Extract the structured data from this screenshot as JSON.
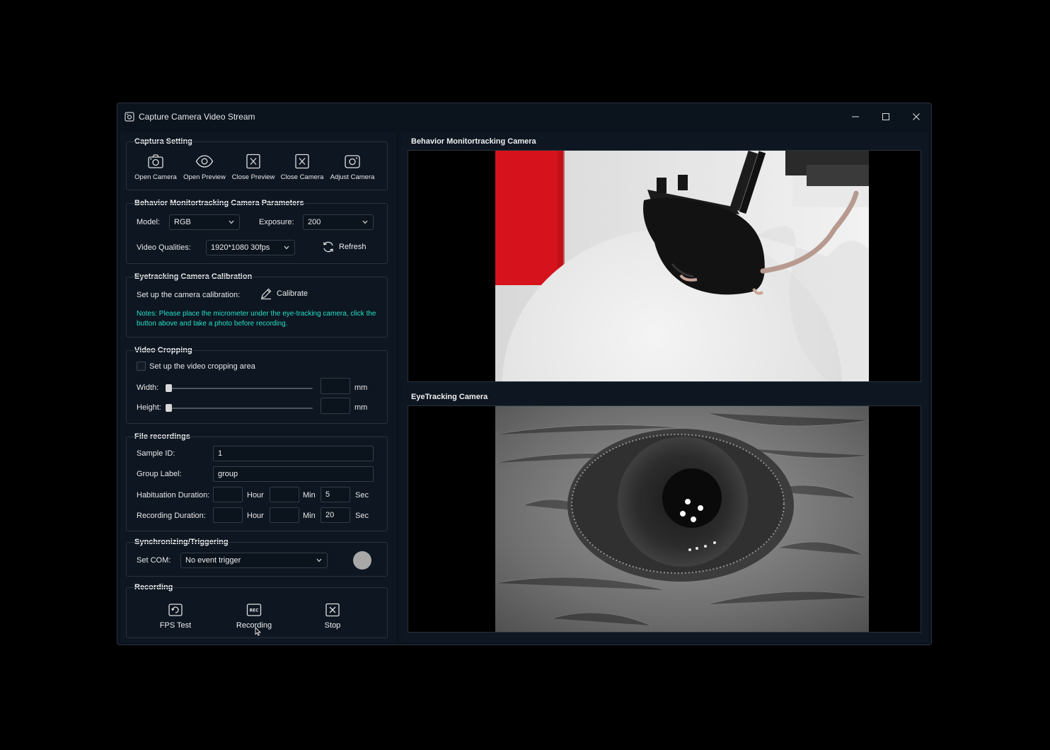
{
  "window": {
    "title": "Capture Camera Video Stream"
  },
  "capture_setting": {
    "title": "Captura Setting",
    "buttons": [
      {
        "label": "Open Camera",
        "icon": "camera-icon"
      },
      {
        "label": "Open Preview",
        "icon": "eye-icon"
      },
      {
        "label": "Close Preview",
        "icon": "close-box-icon"
      },
      {
        "label": "Close Camera",
        "icon": "close-box-icon"
      },
      {
        "label": "Adjust Camera",
        "icon": "camera-icon"
      }
    ]
  },
  "behavior_params": {
    "title": "Behavior Monitortracking Camera Parameters",
    "model_label": "Model:",
    "model_value": "RGB",
    "exposure_label": "Exposure:",
    "exposure_value": "200",
    "quality_label": "Video Qualities:",
    "quality_value": "1920*1080 30fps",
    "refresh_label": "Refresh"
  },
  "calibration": {
    "title": "Eyetracking Camera Calibration",
    "setup_label": "Set up the camera calibration:",
    "calibrate_label": "Calibrate",
    "note": "Notes: Please place the micrometer under the eye-tracking camera, click the button above and take a photo before recording."
  },
  "cropping": {
    "title": "Video Cropping",
    "checkbox_label": "Set up the video cropping area",
    "checked": false,
    "width_label": "Width:",
    "height_label": "Height:",
    "unit": "mm",
    "width_value": "",
    "height_value": ""
  },
  "file_recordings": {
    "title": "File recordings",
    "sample_id_label": "Sample ID:",
    "sample_id_value": "1",
    "group_label_label": "Group Label:",
    "group_label_value": "group",
    "habituation_label": "Habituation Duration:",
    "habituation": {
      "hour": "",
      "min": "",
      "sec": "5"
    },
    "recording_label": "Recording Duration:",
    "recording": {
      "hour": "",
      "min": "",
      "sec": "20"
    },
    "hour_unit": "Hour",
    "min_unit": "Min",
    "sec_unit": "Sec"
  },
  "sync": {
    "title": "Synchronizing/Triggering",
    "com_label": "Set COM:",
    "com_value": "No event trigger",
    "status_color": "#a8a8a8"
  },
  "recording": {
    "title": "Recording",
    "fps_label": "FPS Test",
    "record_label": "Recording",
    "rec_badge": "REC",
    "stop_label": "Stop"
  },
  "cameras": {
    "behavior_title": "Behavior Monitortracking Camera",
    "eye_title": "EyeTracking Camera"
  },
  "colors": {
    "accent_note": "#27e0c6",
    "window_bg": "#0b131d",
    "panel_bg": "#0d1621"
  }
}
